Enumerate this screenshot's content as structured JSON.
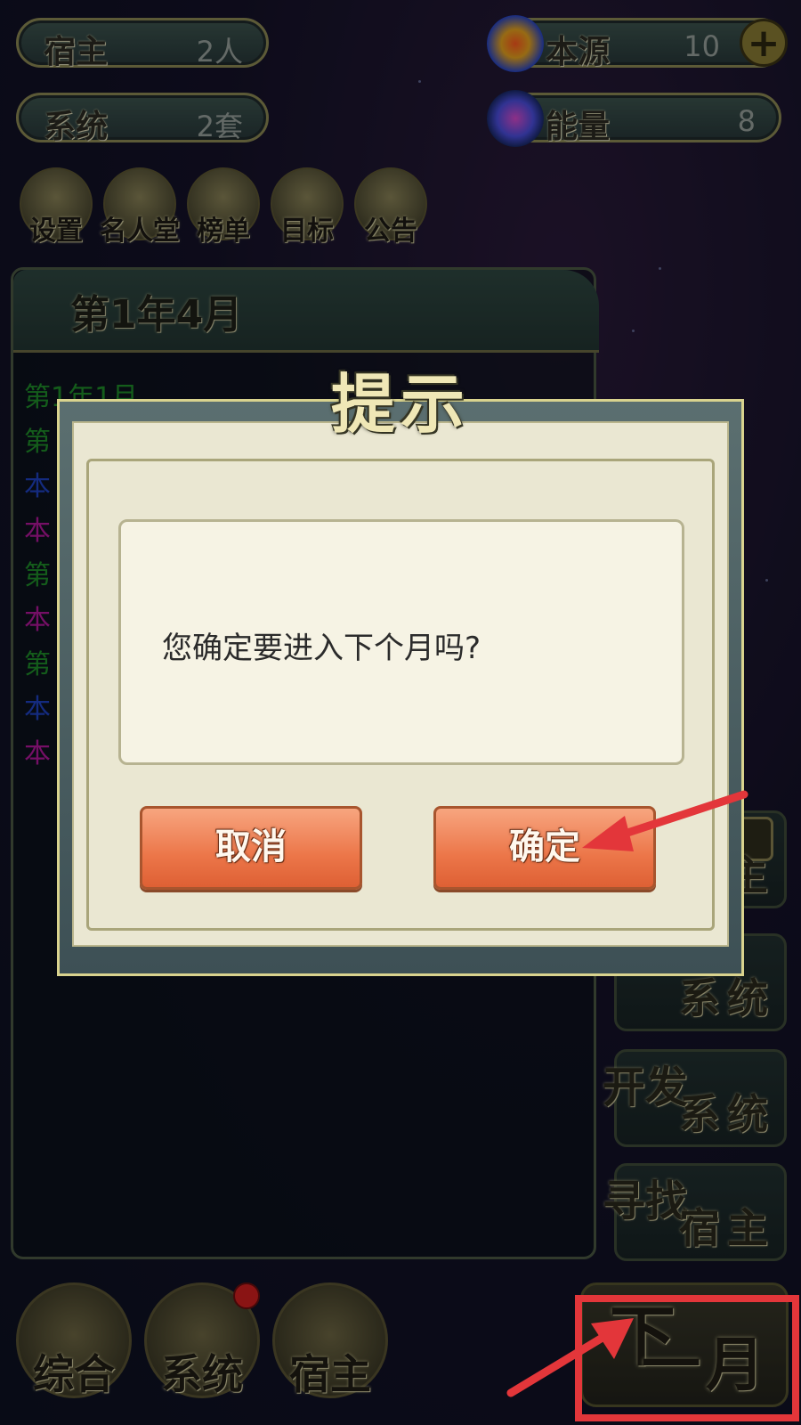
{
  "top_stats": {
    "host": {
      "label": "宿主",
      "value": "2人"
    },
    "system": {
      "label": "系统",
      "value": "2套"
    },
    "source": {
      "label": "本源",
      "value": "10"
    },
    "energy": {
      "label": "能量",
      "value": "8"
    }
  },
  "menu": {
    "settings": "设置",
    "hall_of_fame": "名人堂",
    "ranking": "榜单",
    "goals": "目标",
    "notice": "公告"
  },
  "panel": {
    "title": "第1年4月",
    "log_visible": [
      {
        "text": "第1年1月",
        "color": "#1f8f2a"
      },
      {
        "text": "第",
        "color": "#1f8f2a"
      },
      {
        "text": "本",
        "color": "#1f43c4"
      },
      {
        "text": "本",
        "color": "#b4189d"
      },
      {
        "text": "第",
        "color": "#1f8f2a"
      },
      {
        "text": "本",
        "color": "#b4189d"
      },
      {
        "text": "第",
        "color": "#1f8f2a"
      },
      {
        "text": "本",
        "color": "#1f43c4"
      },
      {
        "text": "本",
        "color": "#b4189d"
      }
    ]
  },
  "side_buttons": {
    "locked_host": {
      "t1": "",
      "t2": "主"
    },
    "system_a": {
      "t1": "",
      "t2": "系统"
    },
    "develop_system": {
      "t1": "开发",
      "t2": "系统"
    },
    "find_host": {
      "t1": "寻找",
      "t2": "宿主"
    }
  },
  "bottom_nav": {
    "overview": "综合",
    "system": "系统",
    "host": "宿主",
    "next_month_1": "下",
    "next_month_2": "一月"
  },
  "dialog": {
    "title": "提示",
    "message": "您确定要进入下个月吗?",
    "cancel_label": "取消",
    "confirm_label": "确定"
  },
  "colors": {
    "annotation_red": "#e3363a",
    "button_orange": "#ec7649"
  }
}
